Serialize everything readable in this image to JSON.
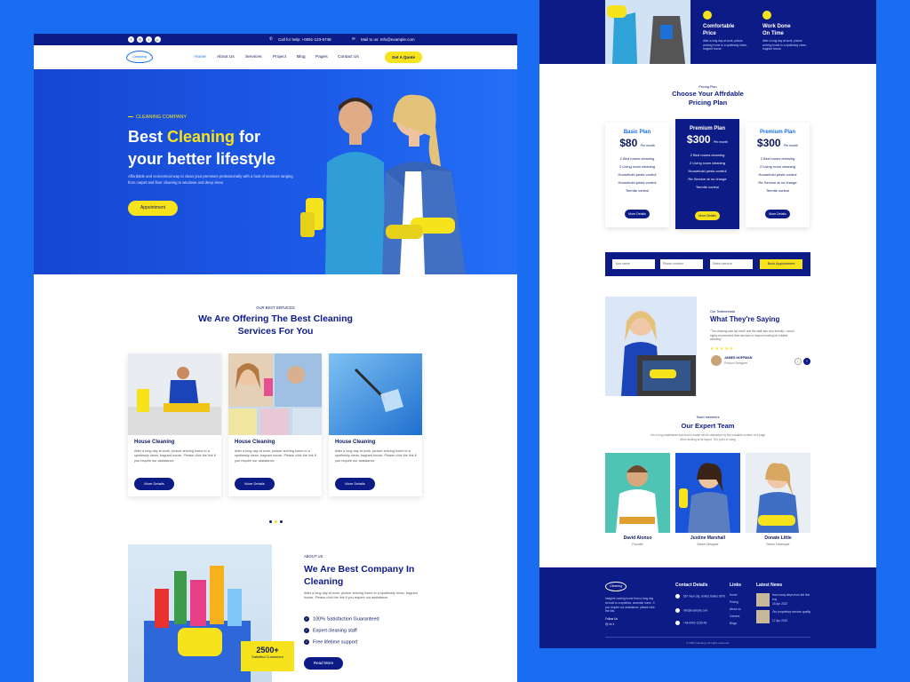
{
  "topbar": {
    "help": "Call for help: +0091-123-6748",
    "mail": "Mail to us: Info@example.com"
  },
  "logo": "Cleaning",
  "nav": {
    "items": [
      "Home",
      "About Us",
      "Services",
      "Project",
      "Blog",
      "Pages",
      "Contact Us"
    ],
    "quote_button": "Get A Quote"
  },
  "hero": {
    "tag": "CLEANING COMPANY",
    "title_pre": "Best ",
    "title_highlight": "Cleaning",
    "title_post": " for",
    "title_line2": "your better lifestyle",
    "description": "Affordable and economical way to clean your premises professionally with a host of services ranging from carpet and floor cleaning to windows and deep clean",
    "button": "Appointment"
  },
  "services": {
    "subtitle": "OUR BEST SERVICES",
    "title_line1": "We Are Offering The Best Cleaning",
    "title_line2": "Services For You",
    "cards": [
      {
        "title": "House Cleaning",
        "desc": "After a long day at work, picture arriving home to a spotlessly clean, fragrant house. Please click the link if you require our assistance.",
        "button": "More Details"
      },
      {
        "title": "House Cleaning",
        "desc": "After a long day at work, picture arriving home to a spotlessly clean, fragrant house. Please click the link if you require our assistance.",
        "button": "More Details"
      },
      {
        "title": "House Cleaning",
        "desc": "After a long day at work, picture arriving home to a spotlessly clean, fragrant house. Please click the link if you require our assistance.",
        "button": "More Details"
      }
    ]
  },
  "about": {
    "subtitle": "ABOUT US",
    "title_line1": "We Are Best Company In",
    "title_line2": "Cleaning",
    "desc": "After a long day at work, picture arriving home to a spotlessly clean, fragrant house. Please click the link if you require our assistance.",
    "checks": [
      "100% Satisfaction Guaranteed",
      "Expert cleaning staff",
      "Free lifetime support"
    ],
    "button": "Read More",
    "badge_number": "2500+",
    "badge_label": "Satisfied Customers"
  },
  "features": [
    {
      "title_l1": "Comfortable",
      "title_l2": "Price",
      "desc": "After a long day at work, picture arriving home to a spotlessly clean, fragrant house."
    },
    {
      "title_l1": "Work Done",
      "title_l2": "On Time",
      "desc": "After a long day at work, picture arriving home to a spotlessly clean, fragrant house."
    }
  ],
  "pricing": {
    "subtitle": "Pricing Plan",
    "title_line1": "Choose Your Affrdable",
    "title_line2": "Pricing Plan",
    "plans": [
      {
        "name": "Basic Plan",
        "price": "$80",
        "per": "Per month",
        "features": [
          "2 Bed rooms cleaning",
          "2 Living room cleaning",
          "Household pests control",
          "Household pests control",
          "Termite control"
        ],
        "button": "More Details"
      },
      {
        "name": "Premium Plan",
        "price": "$300",
        "per": "Per month",
        "features": [
          "2 Bed rooms cleaning",
          "2 Living room cleaning",
          "Household pests control",
          "Re-Service at no charge",
          "Termite control"
        ],
        "button": "More Details"
      },
      {
        "name": "Premium Plan",
        "price": "$300",
        "per": "Per month",
        "features": [
          "2 Bed rooms cleaning",
          "2 Living room cleaning",
          "Household pests control",
          "Re-Service at no charge",
          "Termite control"
        ],
        "button": "More Details"
      }
    ]
  },
  "booking": {
    "name_placeholder": "Your name",
    "phone_placeholder": "Phone number",
    "service_placeholder": "Select service",
    "button": "Book Appointment"
  },
  "testimonial": {
    "subtitle": "Our Testimonials",
    "title": "What They're Saying",
    "text": "\"The cleaning was top notch and the staff was very friendly. I would highly recommend their services to anyone looking for reliable cleaning.\"",
    "stars": "★★★★★",
    "name": "JAMES HOFFMAN",
    "role": "Product Designer"
  },
  "team": {
    "subtitle": "Team members",
    "title": "Our Expert Team",
    "desc": "It is a long established fact that a reader will be distracted by the readable content of a page when looking at its layout. The point of using",
    "members": [
      {
        "name": "David Alonso",
        "role": "Founder"
      },
      {
        "name": "Justine Marshall",
        "role": "Senior Designer"
      },
      {
        "name": "Donate Little",
        "role": "Senior Developer"
      }
    ]
  },
  "footer": {
    "about": "Imagine coming home from a long day at work to a spotless, aromatic home. If you require our assistance, please click the link.",
    "follow": "Follow Us",
    "contact_heading": "Contact Details",
    "contact": [
      "567 New city, United States 9876",
      "info@example.com",
      "+44-6452-1235-45"
    ],
    "links_heading": "Links",
    "links": [
      "Home",
      "Pricing",
      "About us",
      "Careers",
      "Blogs"
    ],
    "news_heading": "Latest News",
    "news": [
      {
        "title": "How many steps from the first buy",
        "date": "16 Apr 2022"
      },
      {
        "title": "Our proprietary window quality",
        "date": "17 Apr 2022"
      }
    ],
    "copyright": "© 2022 Cleaning. All rights reserved."
  }
}
